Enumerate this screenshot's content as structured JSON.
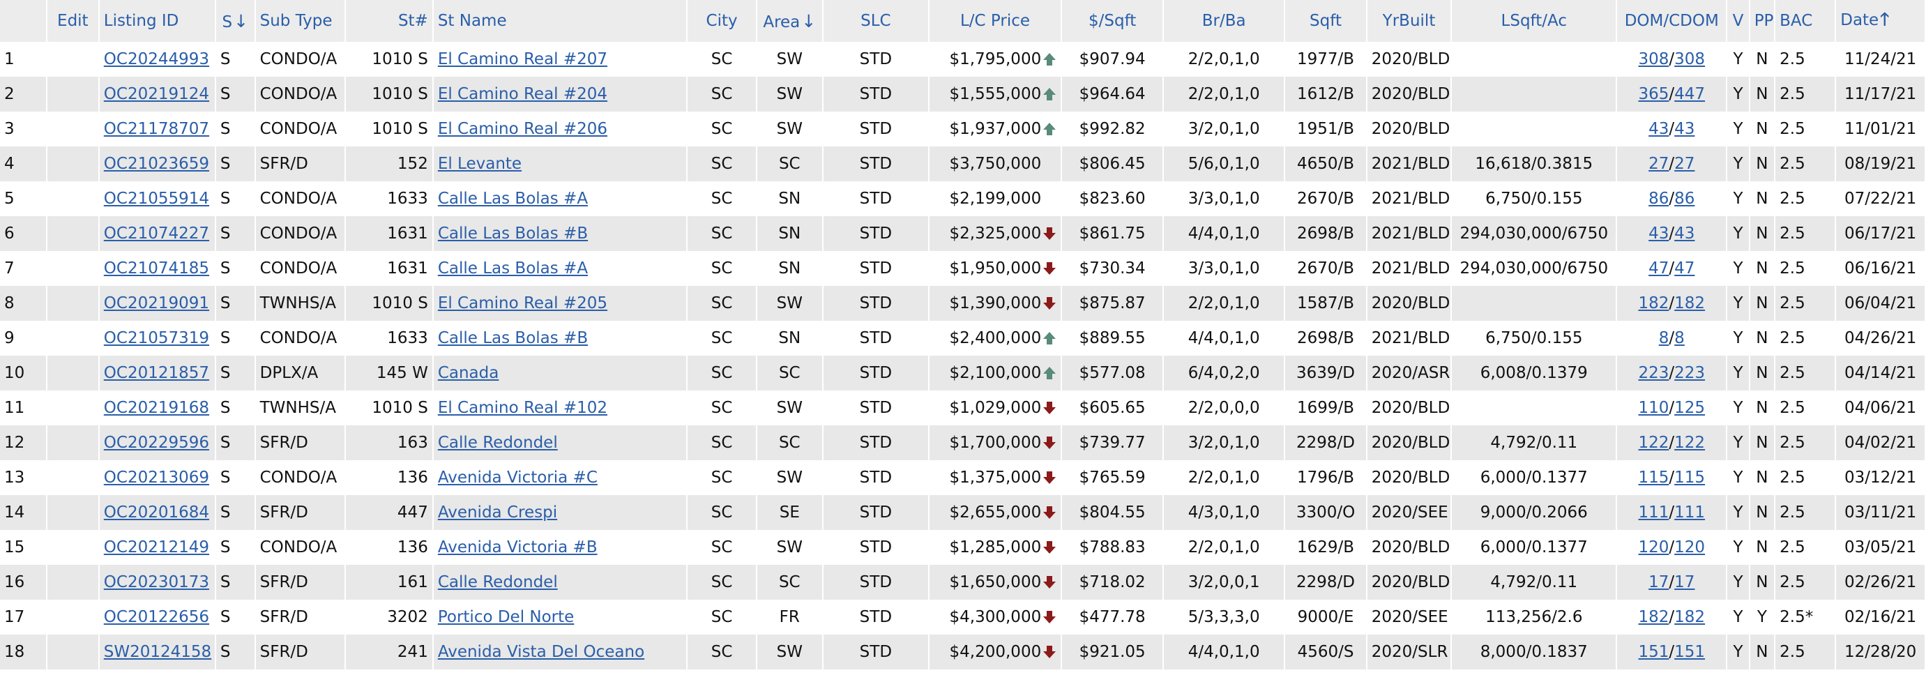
{
  "columns": {
    "num": "",
    "edit": "Edit",
    "listing_id": "Listing ID",
    "s": "S",
    "sub_type": "Sub Type",
    "st_num": "St#",
    "st_name": "St Name",
    "city": "City",
    "area": "Area",
    "slc": "SLC",
    "lc_price": "L/C Price",
    "psqft": "$/Sqft",
    "brba": "Br/Ba",
    "sqft": "Sqft",
    "yrbuilt": "YrBuilt",
    "lsqft": "LSqft/Ac",
    "dom": "DOM/CDOM",
    "v": "V",
    "pp": "PP",
    "bac": "BAC",
    "date": "Date"
  },
  "sort_icons": {
    "s": "sort-descending-arrow-icon",
    "area": "sort-descending-arrow-icon",
    "date": "sort-ascending-arrow-icon"
  },
  "colors": {
    "header_bg": "#ececec",
    "link": "#2a5ea9",
    "arrow_up": "#5a8a7a",
    "arrow_down": "#8b1a1a",
    "row_alt": "#e8e8e8"
  },
  "rows": [
    {
      "n": "1",
      "id": "OC20244993",
      "s": "S",
      "type": "CONDO/A",
      "stnum": "1010 S",
      "stname": "El Camino Real #207",
      "city": "SC",
      "area": "SW",
      "slc": "STD",
      "price": "$1,795,000",
      "trend": "up",
      "psqft": "$907.94",
      "brba": "2/2,0,1,0",
      "sqft": "1977/B",
      "yr": "2020/BLD",
      "lsqft": "",
      "dom": "308",
      "cdom": "308",
      "v": "Y",
      "pp": "N",
      "bac": "2.5",
      "date": "11/24/21"
    },
    {
      "n": "2",
      "id": "OC20219124",
      "s": "S",
      "type": "CONDO/A",
      "stnum": "1010 S",
      "stname": "El Camino Real #204",
      "city": "SC",
      "area": "SW",
      "slc": "STD",
      "price": "$1,555,000",
      "trend": "up",
      "psqft": "$964.64",
      "brba": "2/2,0,1,0",
      "sqft": "1612/B",
      "yr": "2020/BLD",
      "lsqft": "",
      "dom": "365",
      "cdom": "447",
      "v": "Y",
      "pp": "N",
      "bac": "2.5",
      "date": "11/17/21"
    },
    {
      "n": "3",
      "id": "OC21178707",
      "s": "S",
      "type": "CONDO/A",
      "stnum": "1010 S",
      "stname": "El Camino Real #206",
      "city": "SC",
      "area": "SW",
      "slc": "STD",
      "price": "$1,937,000",
      "trend": "up",
      "psqft": "$992.82",
      "brba": "3/2,0,1,0",
      "sqft": "1951/B",
      "yr": "2020/BLD",
      "lsqft": "",
      "dom": "43",
      "cdom": "43",
      "v": "Y",
      "pp": "N",
      "bac": "2.5",
      "date": "11/01/21"
    },
    {
      "n": "4",
      "id": "OC21023659",
      "s": "S",
      "type": "SFR/D",
      "stnum": "152",
      "stname": "El Levante",
      "city": "SC",
      "area": "SC",
      "slc": "STD",
      "price": "$3,750,000",
      "trend": "",
      "psqft": "$806.45",
      "brba": "5/6,0,1,0",
      "sqft": "4650/B",
      "yr": "2021/BLD",
      "lsqft": "16,618/0.3815",
      "dom": "27",
      "cdom": "27",
      "v": "Y",
      "pp": "N",
      "bac": "2.5",
      "date": "08/19/21"
    },
    {
      "n": "5",
      "id": "OC21055914",
      "s": "S",
      "type": "CONDO/A",
      "stnum": "1633",
      "stname": "Calle Las Bolas #A",
      "city": "SC",
      "area": "SN",
      "slc": "STD",
      "price": "$2,199,000",
      "trend": "",
      "psqft": "$823.60",
      "brba": "3/3,0,1,0",
      "sqft": "2670/B",
      "yr": "2021/BLD",
      "lsqft": "6,750/0.155",
      "dom": "86",
      "cdom": "86",
      "v": "Y",
      "pp": "N",
      "bac": "2.5",
      "date": "07/22/21"
    },
    {
      "n": "6",
      "id": "OC21074227",
      "s": "S",
      "type": "CONDO/A",
      "stnum": "1631",
      "stname": "Calle Las Bolas #B",
      "city": "SC",
      "area": "SN",
      "slc": "STD",
      "price": "$2,325,000",
      "trend": "down",
      "psqft": "$861.75",
      "brba": "4/4,0,1,0",
      "sqft": "2698/B",
      "yr": "2021/BLD",
      "lsqft": "294,030,000/6750",
      "dom": "43",
      "cdom": "43",
      "v": "Y",
      "pp": "N",
      "bac": "2.5",
      "date": "06/17/21"
    },
    {
      "n": "7",
      "id": "OC21074185",
      "s": "S",
      "type": "CONDO/A",
      "stnum": "1631",
      "stname": "Calle Las Bolas #A",
      "city": "SC",
      "area": "SN",
      "slc": "STD",
      "price": "$1,950,000",
      "trend": "down",
      "psqft": "$730.34",
      "brba": "3/3,0,1,0",
      "sqft": "2670/B",
      "yr": "2021/BLD",
      "lsqft": "294,030,000/6750",
      "dom": "47",
      "cdom": "47",
      "v": "Y",
      "pp": "N",
      "bac": "2.5",
      "date": "06/16/21"
    },
    {
      "n": "8",
      "id": "OC20219091",
      "s": "S",
      "type": "TWNHS/A",
      "stnum": "1010 S",
      "stname": "El Camino Real #205",
      "city": "SC",
      "area": "SW",
      "slc": "STD",
      "price": "$1,390,000",
      "trend": "down",
      "psqft": "$875.87",
      "brba": "2/2,0,1,0",
      "sqft": "1587/B",
      "yr": "2020/BLD",
      "lsqft": "",
      "dom": "182",
      "cdom": "182",
      "v": "Y",
      "pp": "N",
      "bac": "2.5",
      "date": "06/04/21"
    },
    {
      "n": "9",
      "id": "OC21057319",
      "s": "S",
      "type": "CONDO/A",
      "stnum": "1633",
      "stname": "Calle Las Bolas #B",
      "city": "SC",
      "area": "SN",
      "slc": "STD",
      "price": "$2,400,000",
      "trend": "up",
      "psqft": "$889.55",
      "brba": "4/4,0,1,0",
      "sqft": "2698/B",
      "yr": "2021/BLD",
      "lsqft": "6,750/0.155",
      "dom": "8",
      "cdom": "8",
      "v": "Y",
      "pp": "N",
      "bac": "2.5",
      "date": "04/26/21"
    },
    {
      "n": "10",
      "id": "OC20121857",
      "s": "S",
      "type": "DPLX/A",
      "stnum": "145 W",
      "stname": "Canada",
      "city": "SC",
      "area": "SC",
      "slc": "STD",
      "price": "$2,100,000",
      "trend": "up",
      "psqft": "$577.08",
      "brba": "6/4,0,2,0",
      "sqft": "3639/D",
      "yr": "2020/ASR",
      "lsqft": "6,008/0.1379",
      "dom": "223",
      "cdom": "223",
      "v": "Y",
      "pp": "N",
      "bac": "2.5",
      "date": "04/14/21"
    },
    {
      "n": "11",
      "id": "OC20219168",
      "s": "S",
      "type": "TWNHS/A",
      "stnum": "1010 S",
      "stname": "El Camino Real #102",
      "city": "SC",
      "area": "SW",
      "slc": "STD",
      "price": "$1,029,000",
      "trend": "down",
      "psqft": "$605.65",
      "brba": "2/2,0,0,0",
      "sqft": "1699/B",
      "yr": "2020/BLD",
      "lsqft": "",
      "dom": "110",
      "cdom": "125",
      "v": "Y",
      "pp": "N",
      "bac": "2.5",
      "date": "04/06/21"
    },
    {
      "n": "12",
      "id": "OC20229596",
      "s": "S",
      "type": "SFR/D",
      "stnum": "163",
      "stname": "Calle Redondel",
      "city": "SC",
      "area": "SC",
      "slc": "STD",
      "price": "$1,700,000",
      "trend": "down",
      "psqft": "$739.77",
      "brba": "3/2,0,1,0",
      "sqft": "2298/D",
      "yr": "2020/BLD",
      "lsqft": "4,792/0.11",
      "dom": "122",
      "cdom": "122",
      "v": "Y",
      "pp": "N",
      "bac": "2.5",
      "date": "04/02/21"
    },
    {
      "n": "13",
      "id": "OC20213069",
      "s": "S",
      "type": "CONDO/A",
      "stnum": "136",
      "stname": "Avenida Victoria #C",
      "city": "SC",
      "area": "SW",
      "slc": "STD",
      "price": "$1,375,000",
      "trend": "down",
      "psqft": "$765.59",
      "brba": "2/2,0,1,0",
      "sqft": "1796/B",
      "yr": "2020/BLD",
      "lsqft": "6,000/0.1377",
      "dom": "115",
      "cdom": "115",
      "v": "Y",
      "pp": "N",
      "bac": "2.5",
      "date": "03/12/21"
    },
    {
      "n": "14",
      "id": "OC20201684",
      "s": "S",
      "type": "SFR/D",
      "stnum": "447",
      "stname": "Avenida Crespi",
      "city": "SC",
      "area": "SE",
      "slc": "STD",
      "price": "$2,655,000",
      "trend": "down",
      "psqft": "$804.55",
      "brba": "4/3,0,1,0",
      "sqft": "3300/O",
      "yr": "2020/SEE",
      "lsqft": "9,000/0.2066",
      "dom": "111",
      "cdom": "111",
      "v": "Y",
      "pp": "N",
      "bac": "2.5",
      "date": "03/11/21"
    },
    {
      "n": "15",
      "id": "OC20212149",
      "s": "S",
      "type": "CONDO/A",
      "stnum": "136",
      "stname": "Avenida Victoria #B",
      "city": "SC",
      "area": "SW",
      "slc": "STD",
      "price": "$1,285,000",
      "trend": "down",
      "psqft": "$788.83",
      "brba": "2/2,0,1,0",
      "sqft": "1629/B",
      "yr": "2020/BLD",
      "lsqft": "6,000/0.1377",
      "dom": "120",
      "cdom": "120",
      "v": "Y",
      "pp": "N",
      "bac": "2.5",
      "date": "03/05/21"
    },
    {
      "n": "16",
      "id": "OC20230173",
      "s": "S",
      "type": "SFR/D",
      "stnum": "161",
      "stname": "Calle Redondel",
      "city": "SC",
      "area": "SC",
      "slc": "STD",
      "price": "$1,650,000",
      "trend": "down",
      "psqft": "$718.02",
      "brba": "3/2,0,0,1",
      "sqft": "2298/D",
      "yr": "2020/BLD",
      "lsqft": "4,792/0.11",
      "dom": "17",
      "cdom": "17",
      "v": "Y",
      "pp": "N",
      "bac": "2.5",
      "date": "02/26/21"
    },
    {
      "n": "17",
      "id": "OC20122656",
      "s": "S",
      "type": "SFR/D",
      "stnum": "3202",
      "stname": "Portico Del Norte",
      "city": "SC",
      "area": "FR",
      "slc": "STD",
      "price": "$4,300,000",
      "trend": "down",
      "psqft": "$477.78",
      "brba": "5/3,3,3,0",
      "sqft": "9000/E",
      "yr": "2020/SEE",
      "lsqft": "113,256/2.6",
      "dom": "182",
      "cdom": "182",
      "v": "Y",
      "pp": "Y",
      "bac": "2.5*",
      "date": "02/16/21"
    },
    {
      "n": "18",
      "id": "SW20124158",
      "s": "S",
      "type": "SFR/D",
      "stnum": "241",
      "stname": "Avenida Vista Del Oceano",
      "city": "SC",
      "area": "SW",
      "slc": "STD",
      "price": "$4,200,000",
      "trend": "down",
      "psqft": "$921.05",
      "brba": "4/4,0,1,0",
      "sqft": "4560/S",
      "yr": "2020/SLR",
      "lsqft": "8,000/0.1837",
      "dom": "151",
      "cdom": "151",
      "v": "Y",
      "pp": "N",
      "bac": "2.5",
      "date": "12/28/20"
    }
  ]
}
